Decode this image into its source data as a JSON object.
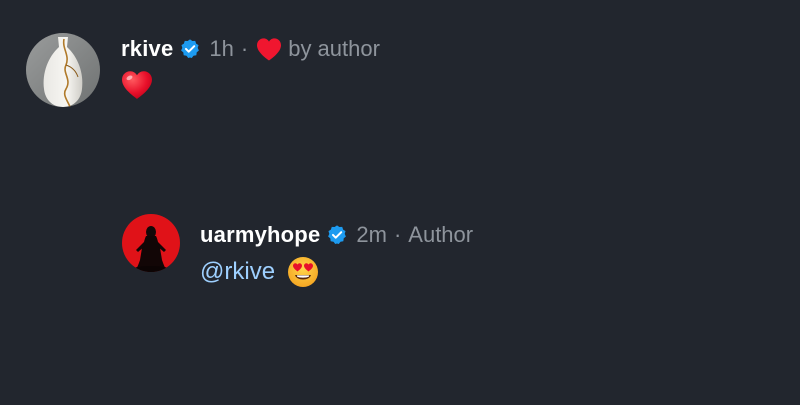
{
  "comments": [
    {
      "username": "rkive",
      "verified": true,
      "time": "1h",
      "separator": "·",
      "liked_label": "by author",
      "content_emoji": "red-heart",
      "avatar": "vase-photo"
    },
    {
      "username": "uarmyhope",
      "verified": true,
      "time": "2m",
      "separator": "·",
      "role_label": "Author",
      "mention": "@rkive",
      "content_emoji": "heart-eyes-face",
      "avatar": "person-red-background"
    }
  ],
  "colors": {
    "background": "#22262e",
    "muted_text": "#8e949c",
    "mention": "#9ed0ff",
    "verified_badge": "#1d9bf0",
    "heart": "#f0162f"
  }
}
